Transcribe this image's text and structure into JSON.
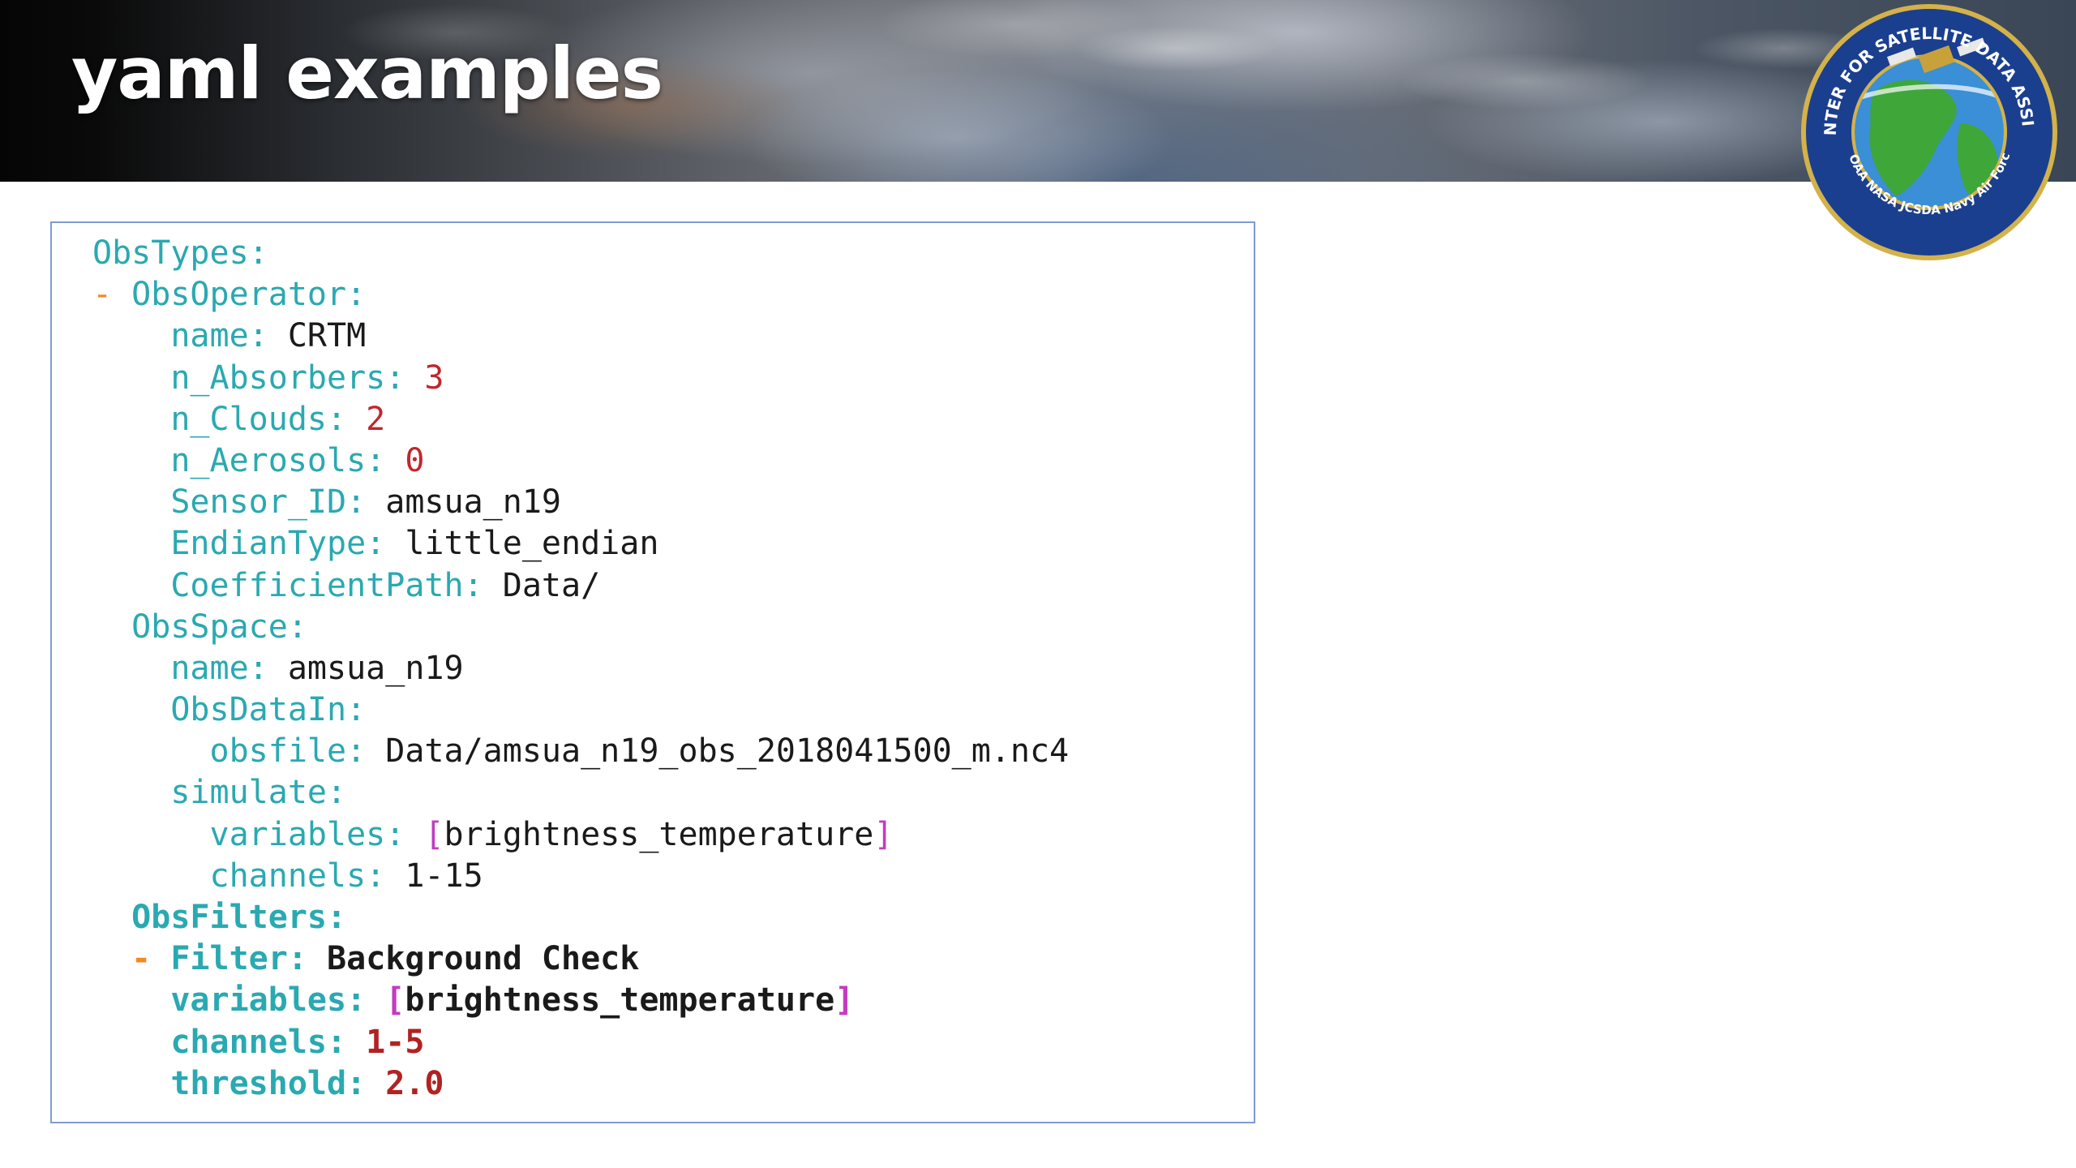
{
  "header": {
    "title": "yaml examples"
  },
  "logo": {
    "ring_text_top": "JOINT CENTER FOR SATELLITE DATA ASSIMILATION",
    "ring_text_bottom": "NOAA  NASA  JCSDA  Navy  Air Force",
    "colors": {
      "ring": "#1b3f8f",
      "border": "#d4b24a",
      "ocean": "#3a8fd6",
      "land": "#3fa63a"
    }
  },
  "code": {
    "lines": [
      {
        "indent": "",
        "dash": "",
        "key": "ObsTypes",
        "value": "",
        "value_type": "none",
        "bold": false
      },
      {
        "indent": "",
        "dash": "- ",
        "key": "ObsOperator",
        "value": "",
        "value_type": "none",
        "bold": false
      },
      {
        "indent": "    ",
        "dash": "",
        "key": "name",
        "value": "CRTM",
        "value_type": "str",
        "bold": false
      },
      {
        "indent": "    ",
        "dash": "",
        "key": "n_Absorbers",
        "value": "3",
        "value_type": "num",
        "bold": false
      },
      {
        "indent": "    ",
        "dash": "",
        "key": "n_Clouds",
        "value": "2",
        "value_type": "num",
        "bold": false
      },
      {
        "indent": "    ",
        "dash": "",
        "key": "n_Aerosols",
        "value": "0",
        "value_type": "num",
        "bold": false
      },
      {
        "indent": "    ",
        "dash": "",
        "key": "Sensor_ID",
        "value": "amsua_n19",
        "value_type": "str",
        "bold": false
      },
      {
        "indent": "    ",
        "dash": "",
        "key": "EndianType",
        "value": "little_endian",
        "value_type": "str",
        "bold": false
      },
      {
        "indent": "    ",
        "dash": "",
        "key": "CoefficientPath",
        "value": "Data/",
        "value_type": "str",
        "bold": false
      },
      {
        "indent": "  ",
        "dash": "",
        "key": "ObsSpace",
        "value": "",
        "value_type": "none",
        "bold": false
      },
      {
        "indent": "    ",
        "dash": "",
        "key": "name",
        "value": "amsua_n19",
        "value_type": "str",
        "bold": false
      },
      {
        "indent": "    ",
        "dash": "",
        "key": "ObsDataIn",
        "value": "",
        "value_type": "none",
        "bold": false
      },
      {
        "indent": "      ",
        "dash": "",
        "key": "obsfile",
        "value": "Data/amsua_n19_obs_2018041500_m.nc4",
        "value_type": "str",
        "bold": false
      },
      {
        "indent": "    ",
        "dash": "",
        "key": "simulate",
        "value": "",
        "value_type": "none",
        "bold": false
      },
      {
        "indent": "      ",
        "dash": "",
        "key": "variables",
        "value": "brightness_temperature",
        "value_type": "list",
        "bold": false
      },
      {
        "indent": "      ",
        "dash": "",
        "key": "channels",
        "value": "1-15",
        "value_type": "str",
        "bold": false
      },
      {
        "indent": "  ",
        "dash": "",
        "key": "ObsFilters",
        "value": "",
        "value_type": "none",
        "bold": true
      },
      {
        "indent": "  ",
        "dash": "- ",
        "key": "Filter",
        "value": "Background Check",
        "value_type": "str",
        "bold": true
      },
      {
        "indent": "    ",
        "dash": "",
        "key": "variables",
        "value": "brightness_temperature",
        "value_type": "list",
        "bold": true
      },
      {
        "indent": "    ",
        "dash": "",
        "key": "channels",
        "value": "1-5",
        "value_type": "num",
        "bold": true
      },
      {
        "indent": "    ",
        "dash": "",
        "key": "threshold",
        "value": "2.0",
        "value_type": "num",
        "bold": true
      }
    ]
  }
}
